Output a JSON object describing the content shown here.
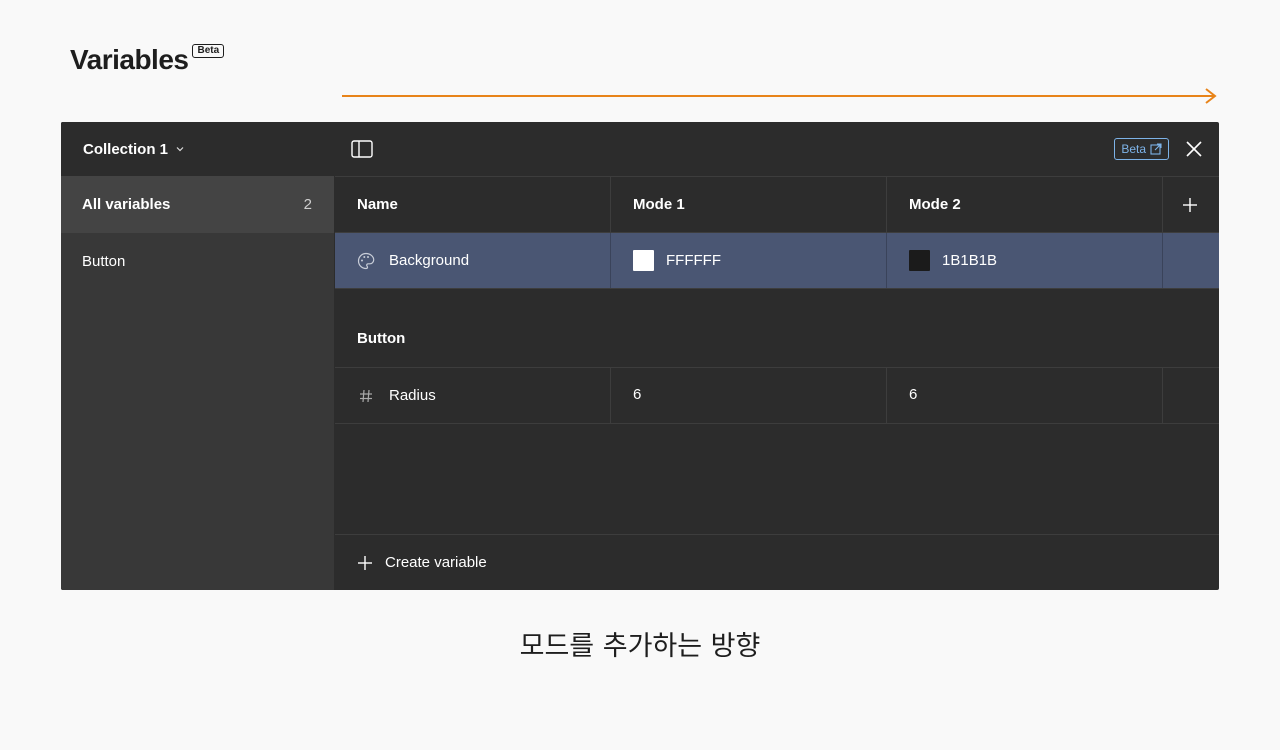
{
  "page": {
    "title": "Variables",
    "title_badge": "Beta",
    "caption": "모드를 추가하는 방향",
    "arrow_color": "#e8841a"
  },
  "sidebar": {
    "collection_label": "Collection 1",
    "items": [
      {
        "label": "All variables",
        "count": "2"
      },
      {
        "label": "Button"
      }
    ]
  },
  "toolbar": {
    "beta_label": "Beta"
  },
  "table": {
    "headers": [
      "Name",
      "Mode 1",
      "Mode 2"
    ],
    "rows": [
      {
        "icon": "palette-icon",
        "name": "Background",
        "mode1": "FFFFFF",
        "mode1_color": "#FFFFFF",
        "mode2": "1B1B1B",
        "mode2_color": "#1B1B1B"
      }
    ],
    "groups": [
      {
        "title": "Button",
        "rows": [
          {
            "icon": "hash-icon",
            "name": "Radius",
            "mode1": "6",
            "mode2": "6"
          }
        ]
      }
    ]
  },
  "footer": {
    "create_label": "Create variable"
  },
  "colors": {
    "panel_bg": "#2c2c2c",
    "sidebar_bg": "#383838",
    "selected_row": "#4a5673",
    "accent_link": "#7db3e8"
  }
}
